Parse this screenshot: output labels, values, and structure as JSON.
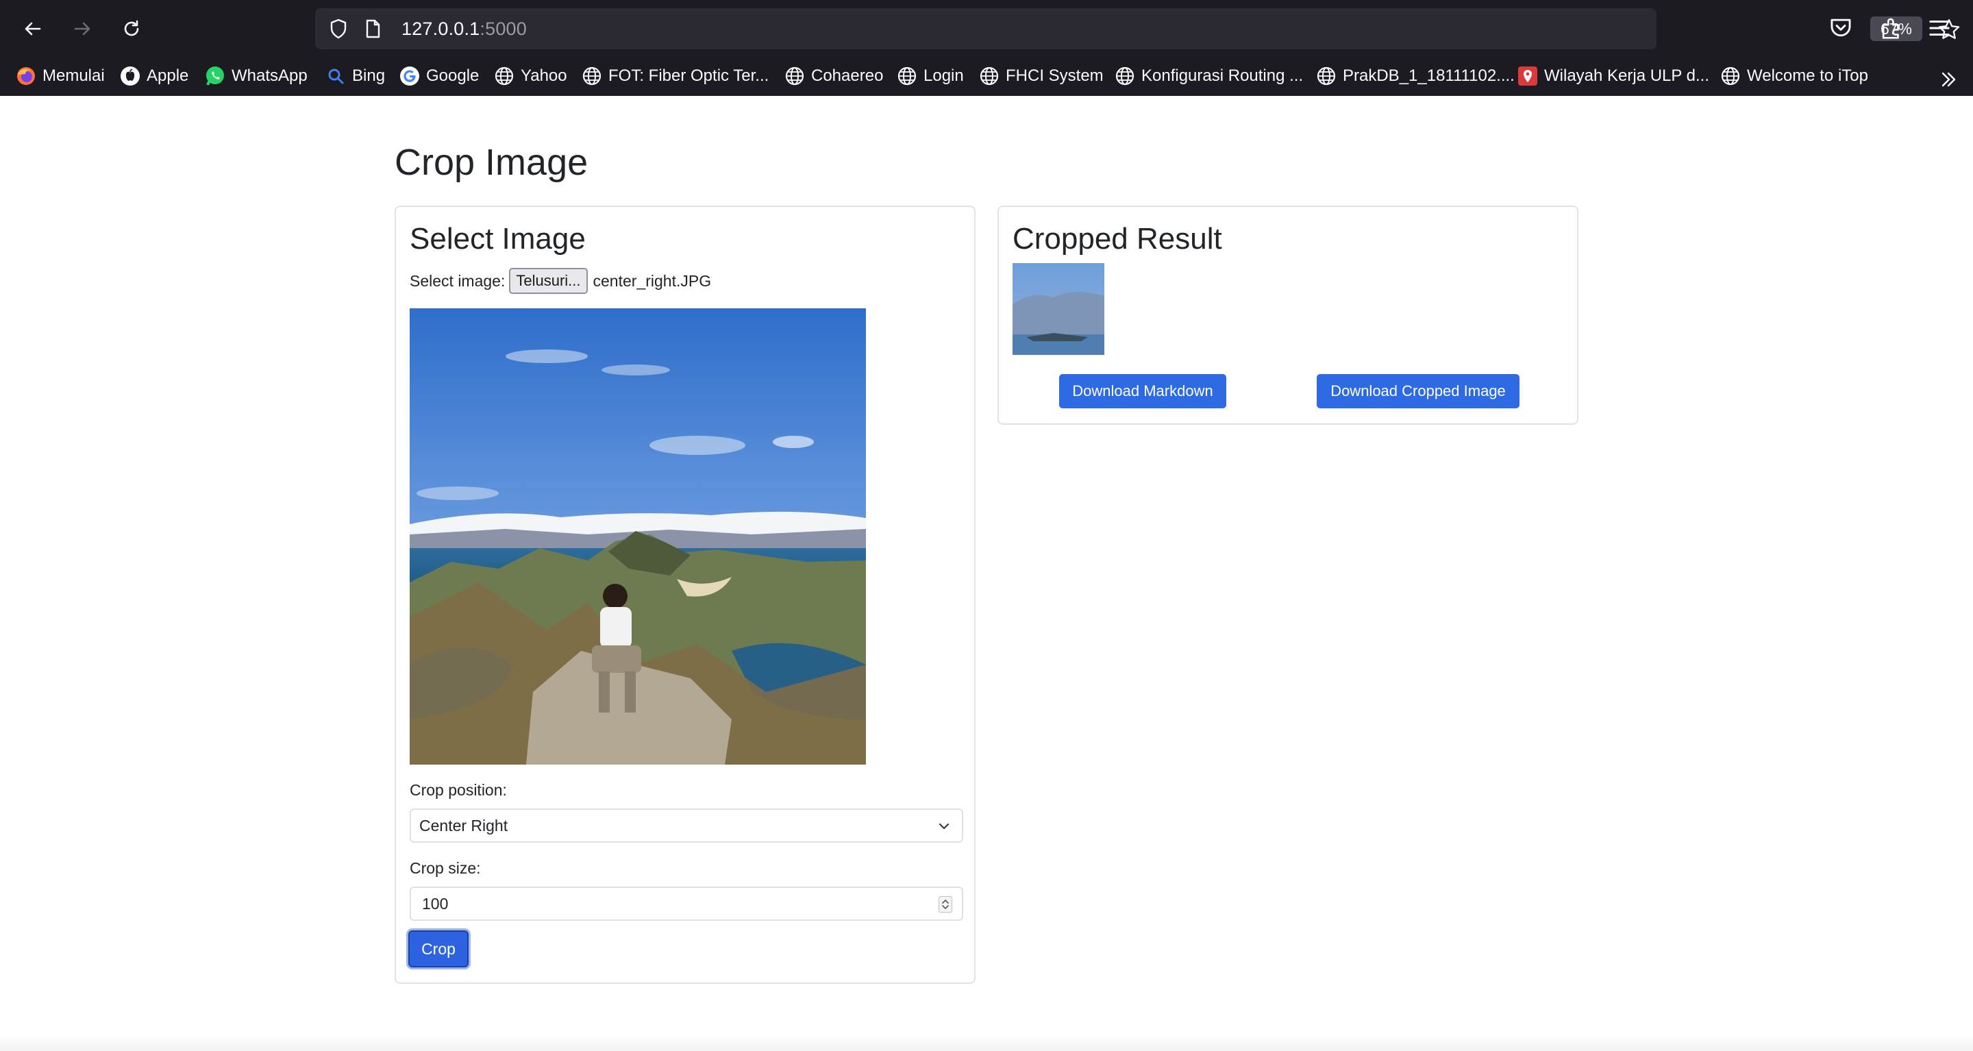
{
  "browser": {
    "url_host": "127.0.0.1",
    "url_port": ":5000",
    "zoom": "67%",
    "bookmarks": [
      {
        "label": "Memulai",
        "icon": "firefox-icon"
      },
      {
        "label": "Apple",
        "icon": "apple-icon"
      },
      {
        "label": "WhatsApp",
        "icon": "whatsapp-icon"
      },
      {
        "label": "Bing",
        "icon": "search-icon"
      },
      {
        "label": "Google",
        "icon": "google-icon"
      },
      {
        "label": "Yahoo",
        "icon": "globe-icon"
      },
      {
        "label": "FOT: Fiber Optic Ter...",
        "icon": "globe-icon"
      },
      {
        "label": "Cohaereo",
        "icon": "globe-icon"
      },
      {
        "label": "Login",
        "icon": "globe-icon"
      },
      {
        "label": "FHCI System",
        "icon": "globe-icon"
      },
      {
        "label": "Konfigurasi Routing ...",
        "icon": "globe-icon"
      },
      {
        "label": "PrakDB_1_18111102....",
        "icon": "globe-icon"
      },
      {
        "label": "Wilayah Kerja ULP d...",
        "icon": "map-pin-icon"
      },
      {
        "label": "Welcome to iTop",
        "icon": "globe-icon"
      }
    ]
  },
  "page": {
    "title": "Crop Image",
    "select_card": {
      "title": "Select Image",
      "file_label": "Select image:",
      "file_button": "Telusuri...",
      "file_name": "center_right.JPG",
      "crop_position_label": "Crop position:",
      "crop_position_value": "Center Right",
      "crop_size_label": "Crop size:",
      "crop_size_value": "100",
      "crop_button": "Crop"
    },
    "result_card": {
      "title": "Cropped Result",
      "download_markdown": "Download Markdown",
      "download_image": "Download Cropped Image"
    }
  },
  "colors": {
    "browser_chrome": "#1c1b22",
    "url_bar": "#2b2a33",
    "primary_button": "#2d6ae3"
  }
}
